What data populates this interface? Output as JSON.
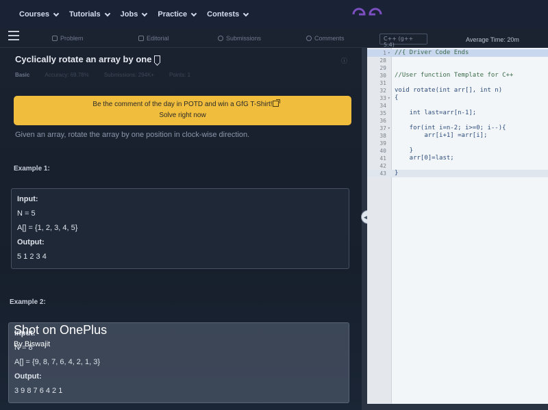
{
  "nav": {
    "items": [
      {
        "label": "Courses"
      },
      {
        "label": "Tutorials"
      },
      {
        "label": "Jobs"
      },
      {
        "label": "Practice"
      },
      {
        "label": "Contests"
      }
    ]
  },
  "tabs": {
    "problem": "Problem",
    "editorial": "Editorial",
    "submissions": "Submissions",
    "comments": "Comments",
    "language": "C++ (g++ 5.4)",
    "avg_time": "Average Time: 20m"
  },
  "problem": {
    "title": "Cyclically rotate an array by one",
    "difficulty": "Basic",
    "accuracy": "Accuracy: 69.78%",
    "submissions": "Submissions: 294K+",
    "points": "Points: 1",
    "potd_line1": "Be the comment of the day in POTD and win a GfG T-Shirt!",
    "potd_line2": "Solve right now",
    "description": "Given an array, rotate the array by one position in clock-wise direction.",
    "example1_heading": "Example 1:",
    "example1": {
      "input_label": "Input:",
      "n": "N = 5",
      "arr": "A[] = {1, 2, 3, 4, 5}",
      "output_label": "Output:",
      "output": "5 1 2 3 4"
    },
    "example2_heading": "Example 2:",
    "example2": {
      "input_label": "Input:",
      "n": "N = 8",
      "arr": "A[] = {9, 8, 7, 6, 4, 2, 1, 3}",
      "output_label": "Output:",
      "output": "3 9 8 7 6 4 2 1"
    }
  },
  "watermark": {
    "main": "Shot on OnePlus",
    "sub": "By Biswajit"
  },
  "editor": {
    "lines": [
      {
        "n": "1",
        "text": "//{ Driver Code Ends",
        "fold": true,
        "comment": true
      },
      {
        "n": "28",
        "text": ""
      },
      {
        "n": "29",
        "text": ""
      },
      {
        "n": "30",
        "text": "//User function Template for C++",
        "comment": true
      },
      {
        "n": "31",
        "text": ""
      },
      {
        "n": "32",
        "text": "void rotate(int arr[], int n)"
      },
      {
        "n": "33",
        "text": "{",
        "fold": true
      },
      {
        "n": "34",
        "text": ""
      },
      {
        "n": "35",
        "text": "    int last=arr[n-1];"
      },
      {
        "n": "36",
        "text": ""
      },
      {
        "n": "37",
        "text": "    for(int i=n-2; i>=0; i--){",
        "fold": true
      },
      {
        "n": "38",
        "text": "        arr[i+1] =arr[i];"
      },
      {
        "n": "39",
        "text": ""
      },
      {
        "n": "40",
        "text": "    }"
      },
      {
        "n": "41",
        "text": "    arr[0]=last;"
      },
      {
        "n": "42",
        "text": ""
      },
      {
        "n": "43",
        "text": "}"
      }
    ]
  }
}
